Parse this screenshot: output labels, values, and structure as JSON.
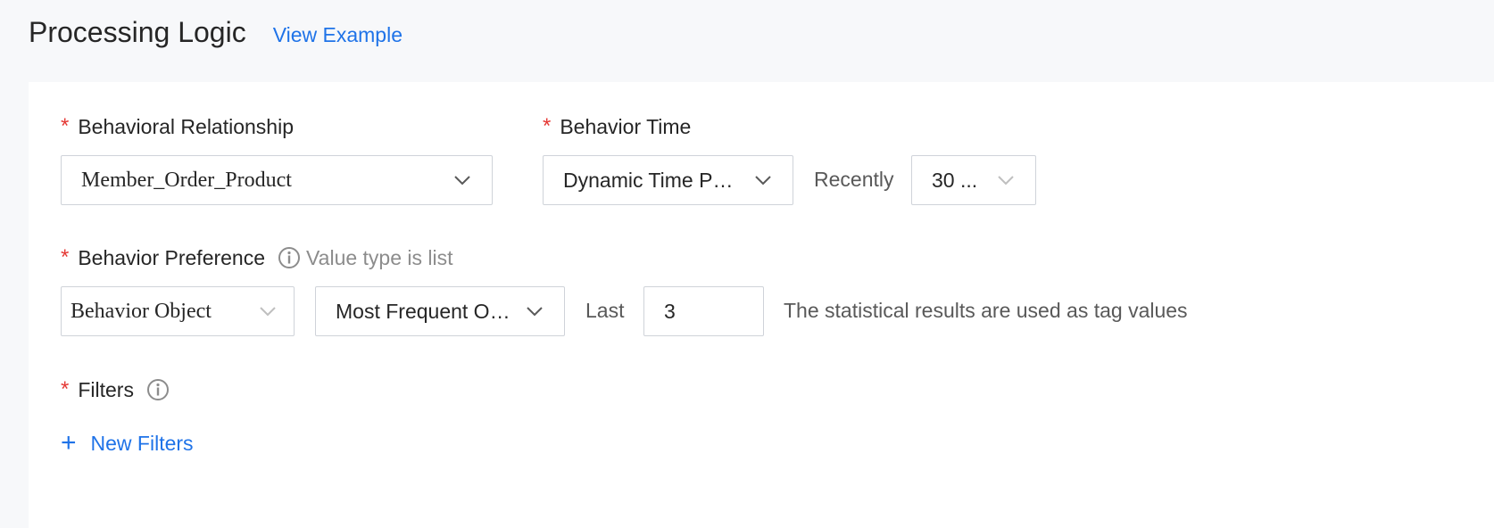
{
  "header": {
    "title": "Processing Logic",
    "view_example": "View Example"
  },
  "form": {
    "required_mark": "*",
    "behavioral_relationship": {
      "label": "Behavioral Relationship",
      "value": "Member_Order_Product"
    },
    "behavior_time": {
      "label": "Behavior Time",
      "mode": "Dynamic Time Per...",
      "recently_label": "Recently",
      "period": "30 ..."
    },
    "behavior_preference": {
      "label": "Behavior Preference",
      "hint": "Value type is list",
      "object": "Behavior Object",
      "method": "Most Frequent Oc...",
      "last_label": "Last",
      "last_value": "3",
      "note": "The statistical results are used as tag values"
    },
    "filters": {
      "label": "Filters",
      "add_button": "New Filters"
    }
  },
  "colors": {
    "accent": "#1f73e8",
    "required": "#e53935",
    "border": "#cfd3d9",
    "background": "#f7f8fa"
  },
  "icons": {
    "dropdown": "chevron-down-icon",
    "info": "info-icon",
    "add": "plus-icon"
  }
}
